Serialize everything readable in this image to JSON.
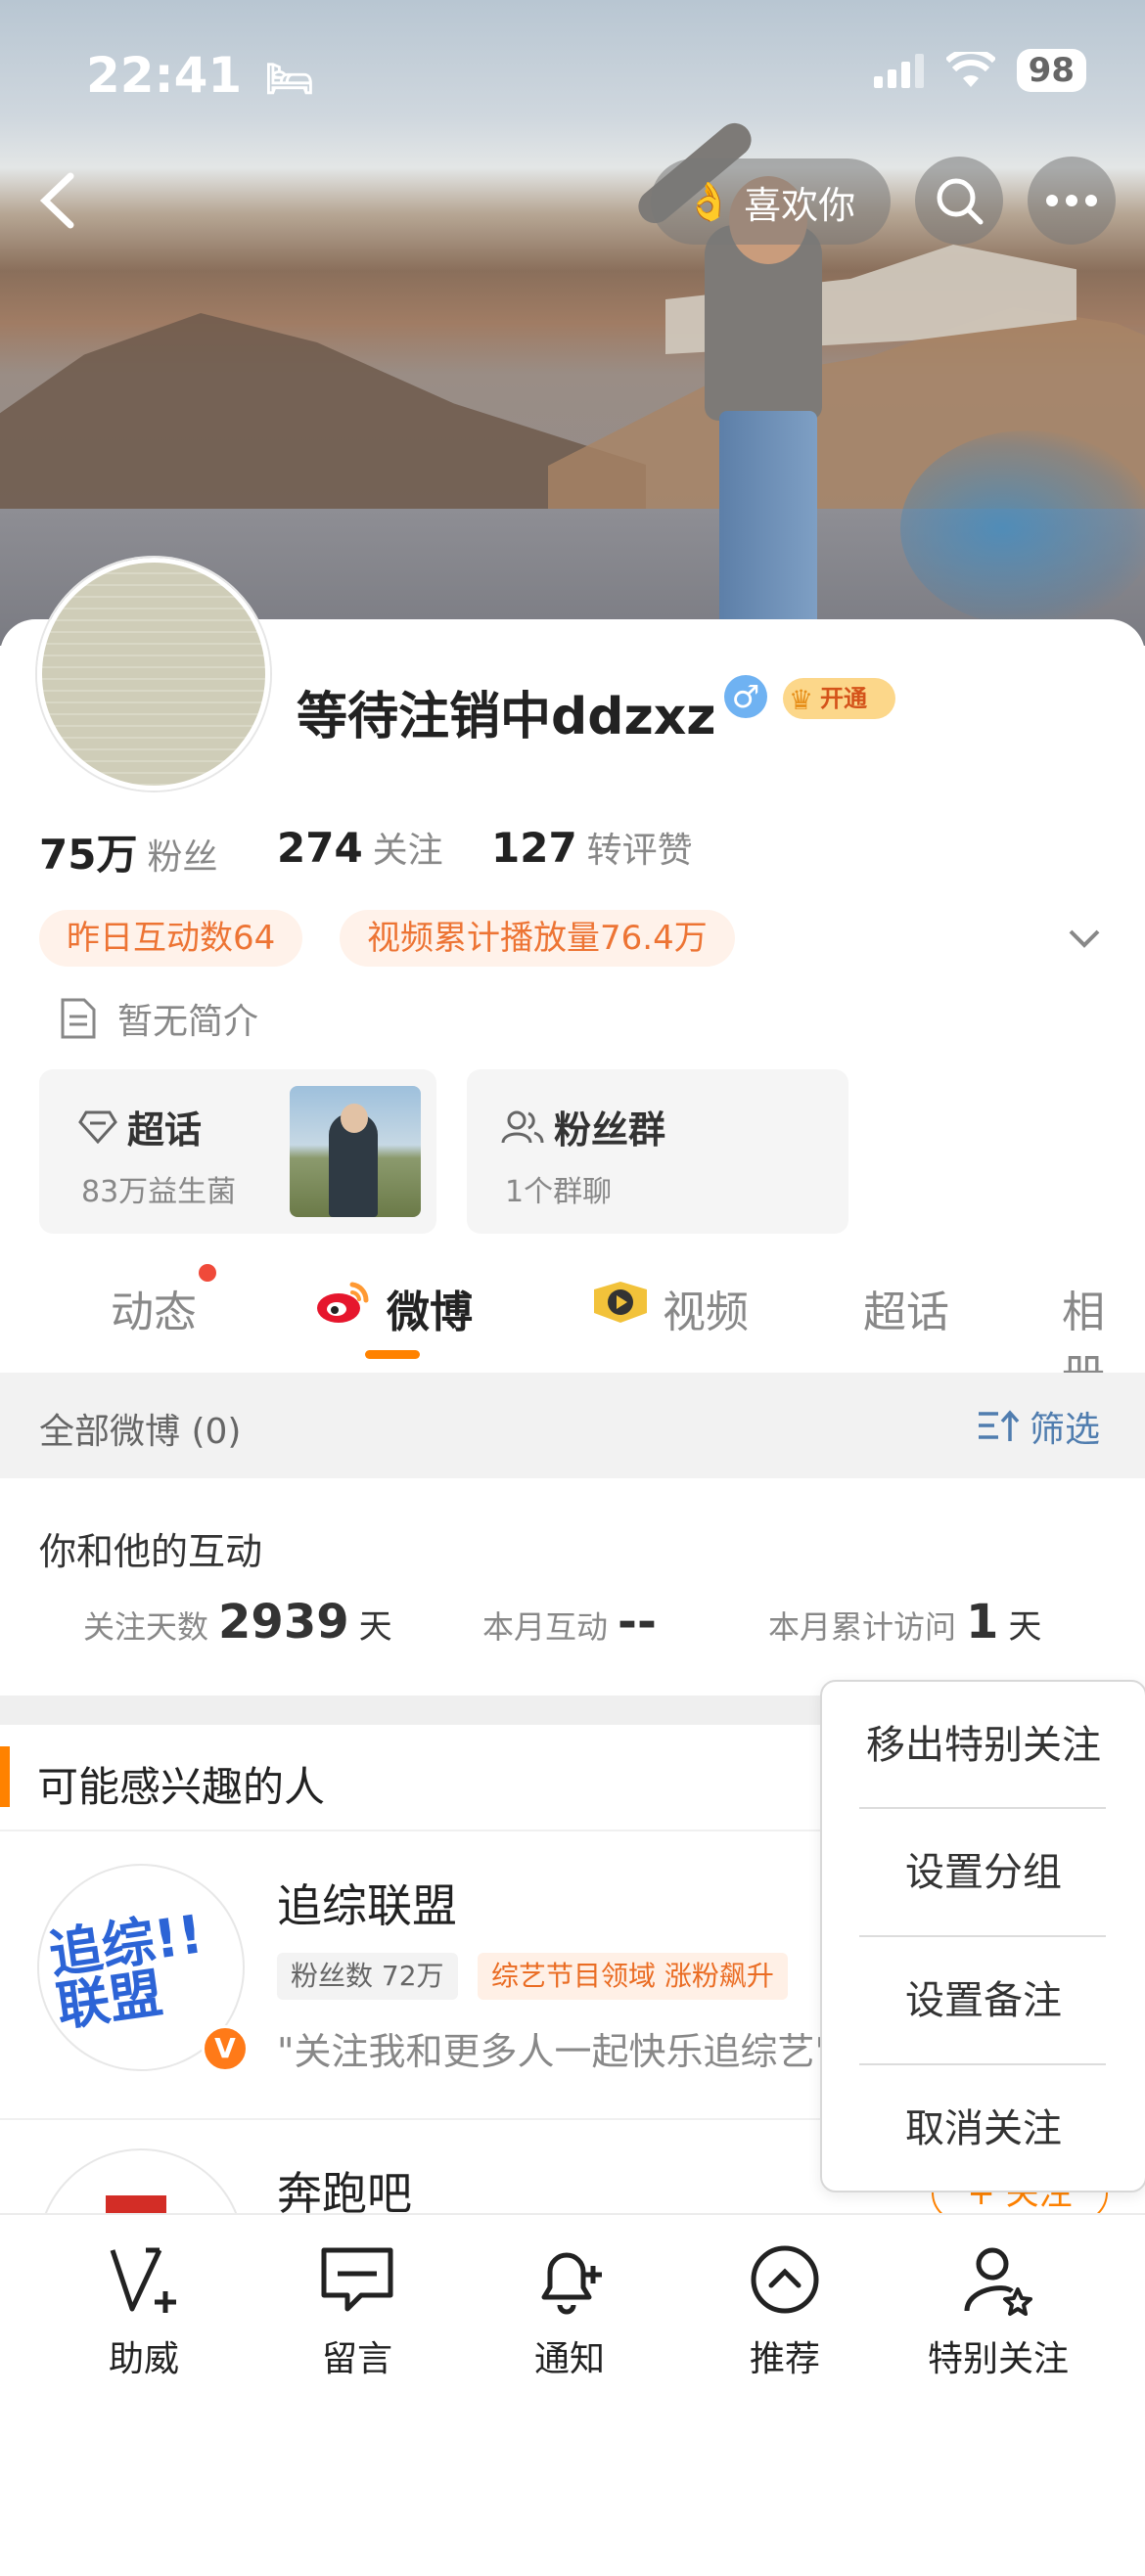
{
  "status": {
    "time": "22:41",
    "battery": "98"
  },
  "nav": {
    "like_label": "喜欢你"
  },
  "profile": {
    "name": "等待注销中ddzxz",
    "gender_symbol": "♂",
    "vip_label": "开通",
    "stats": [
      {
        "num": "75万",
        "label": "粉丝"
      },
      {
        "num": "274",
        "label": "关注"
      },
      {
        "num": "127",
        "label": "转评赞"
      }
    ],
    "pills": [
      "昨日互动数64",
      "视频累计播放量76.4万"
    ],
    "intro": "暂无简介",
    "boxes": [
      {
        "title": "超话",
        "sub": "83万益生菌"
      },
      {
        "title": "粉丝群",
        "sub": "1个群聊"
      }
    ]
  },
  "tabs": [
    "动态",
    "微博",
    "视频",
    "超话",
    "相册"
  ],
  "filter": {
    "left": "全部微博 (0)",
    "right": "筛选"
  },
  "interaction": {
    "title": "你和他的互动",
    "items": [
      {
        "label": "关注天数",
        "num": "2939",
        "unit": "天"
      },
      {
        "label": "本月互动",
        "num": "--",
        "unit": ""
      },
      {
        "label": "本月累计访问",
        "num": "1",
        "unit": "天"
      }
    ]
  },
  "recommend": {
    "title": "可能感兴趣的人",
    "people": [
      {
        "name": "追综联盟",
        "logo": "追综!!联盟",
        "tag1": "粉丝数 72万",
        "tag2": "综艺节目领域 涨粉飙升",
        "desc": "\"关注我和更多人一起快乐追综艺\""
      },
      {
        "name": "奔跑吧",
        "follow": "+ 关注"
      }
    ]
  },
  "menu": [
    "移出特别关注",
    "设置分组",
    "设置备注",
    "取消关注"
  ],
  "bottom_bar": [
    "助威",
    "留言",
    "通知",
    "推荐",
    "特别关注"
  ],
  "colors": {
    "accent": "#ff8200",
    "pill_text": "#ed7434",
    "link": "#507daf"
  }
}
